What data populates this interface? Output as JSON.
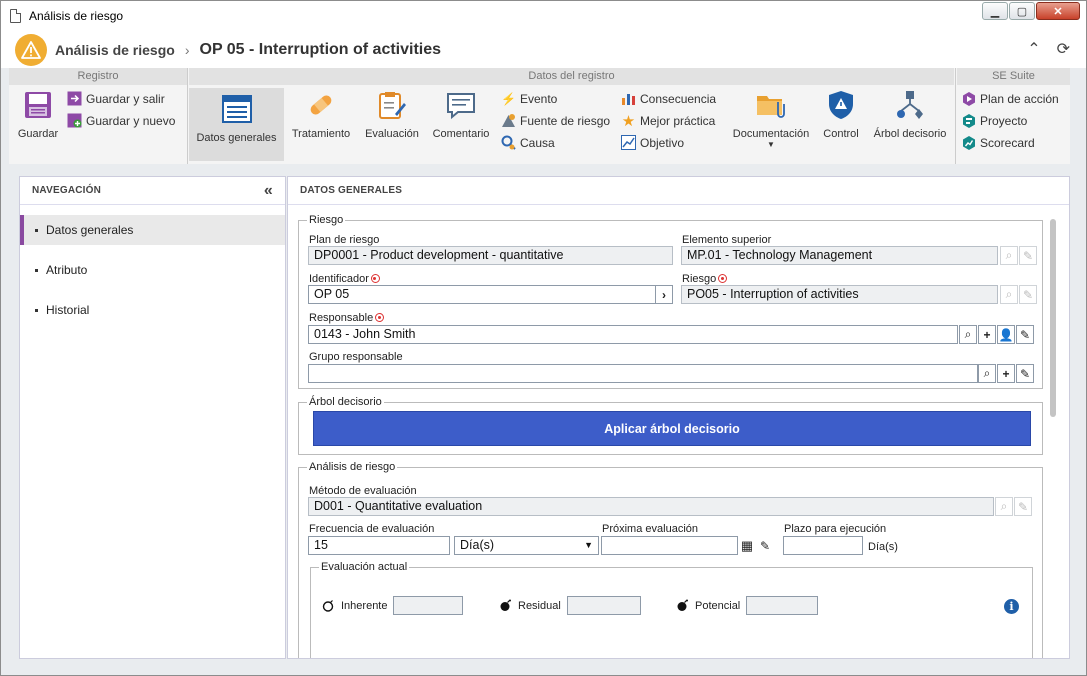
{
  "window": {
    "title": "Análisis de riesgo"
  },
  "header": {
    "app": "Análisis de riesgo",
    "sep": "›",
    "title": "OP 05 - Interruption of activities"
  },
  "ribbon": {
    "groups": {
      "registro": "Registro",
      "datos": "Datos del registro",
      "suite": "SE Suite"
    },
    "guardar": "Guardar",
    "guardar_salir": "Guardar y salir",
    "guardar_nuevo": "Guardar y nuevo",
    "datos_generales": "Datos generales",
    "tratamiento": "Tratamiento",
    "evaluacion": "Evaluación",
    "comentario": "Comentario",
    "evento": "Evento",
    "fuente": "Fuente de riesgo",
    "causa": "Causa",
    "consecuencia": "Consecuencia",
    "mejor_practica": "Mejor práctica",
    "objetivo": "Objetivo",
    "documentacion": "Documentación",
    "control": "Control",
    "arbol": "Árbol decisorio",
    "plan_accion": "Plan de acción",
    "proyecto": "Proyecto",
    "scorecard": "Scorecard"
  },
  "nav": {
    "title": "NAVEGACIÓN",
    "collapse": "«",
    "items": [
      "Datos generales",
      "Atributo",
      "Historial"
    ]
  },
  "main": {
    "title": "DATOS GENERALES",
    "riesgo_legend": "Riesgo",
    "plan_label": "Plan de riesgo",
    "plan_value": "DP0001 - Product development - quantitative",
    "elemento_label": "Elemento superior",
    "elemento_value": "MP.01 - Technology Management",
    "identificador_label": "Identificador",
    "identificador_value": "OP 05",
    "riesgo_label": "Riesgo",
    "riesgo_value": "PO05 - Interruption of activities",
    "responsable_label": "Responsable",
    "responsable_value": "0143 - John Smith",
    "grupo_label": "Grupo responsable",
    "grupo_value": "",
    "arbol_legend": "Árbol decisorio",
    "aplicar_arbol": "Aplicar árbol decisorio",
    "analisis_legend": "Análisis de riesgo",
    "metodo_label": "Método de evaluación",
    "metodo_value": "D001 - Quantitative evaluation",
    "frecuencia_label": "Frecuencia de evaluación",
    "frecuencia_value": "15",
    "frecuencia_unit": "Día(s)",
    "proxima_label": "Próxima evaluación",
    "proxima_value": "",
    "plazo_label": "Plazo para ejecución",
    "plazo_value": "",
    "plazo_unit": "Día(s)",
    "eval_actual_legend": "Evaluación actual",
    "inherente": "Inherente",
    "residual": "Residual",
    "potencial": "Potencial"
  },
  "colors": {
    "accent": "#3d5dc9",
    "nav_active": "#8a4aa0",
    "warning": "#f0ad32"
  }
}
